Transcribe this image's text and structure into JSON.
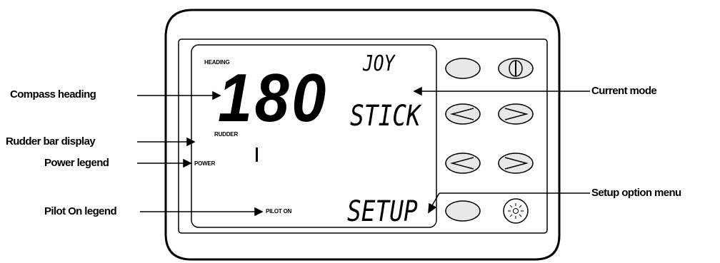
{
  "callouts": {
    "compass_heading": "Compass heading",
    "rudder_bar": "Rudder bar display",
    "power_legend": "Power legend",
    "pilot_on": "Pilot On legend",
    "current_mode": "Current mode",
    "setup_menu": "Setup option menu"
  },
  "lcd": {
    "heading_label": "HEADING",
    "heading_value": "180",
    "mode_line1": "JOY",
    "mode_line2": "STICK",
    "rudder_label": "RUDDER",
    "rudder_bar": "I",
    "power_label": "POWER",
    "pilot_label": "PILOT ON",
    "setup_label": "SETUP"
  },
  "buttons": {
    "row1": [
      "blank",
      "power-icon"
    ],
    "row2": [
      "left-chevron-icon",
      "right-chevron-icon"
    ],
    "row3": [
      "left-chevron-icon",
      "right-chevron-icon"
    ],
    "row4": [
      "blank",
      "lamp-icon"
    ]
  },
  "colors": {
    "line": "#000000",
    "button_fill": "#e8e8e8",
    "background": "#ffffff"
  }
}
